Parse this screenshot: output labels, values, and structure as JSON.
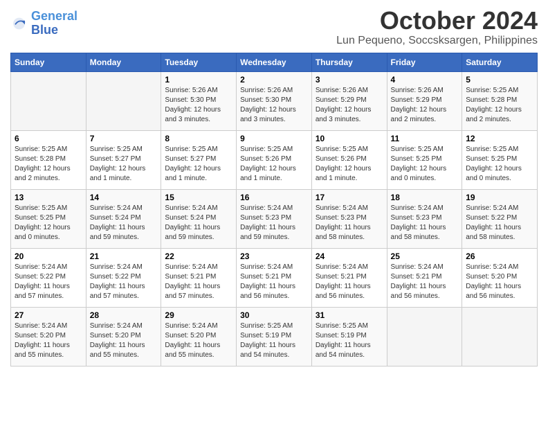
{
  "logo": {
    "text1": "General",
    "text2": "Blue"
  },
  "title": "October 2024",
  "subtitle": "Lun Pequeno, Soccsksargen, Philippines",
  "header_days": [
    "Sunday",
    "Monday",
    "Tuesday",
    "Wednesday",
    "Thursday",
    "Friday",
    "Saturday"
  ],
  "weeks": [
    [
      {
        "day": "",
        "sunrise": "",
        "sunset": "",
        "daylight": ""
      },
      {
        "day": "",
        "sunrise": "",
        "sunset": "",
        "daylight": ""
      },
      {
        "day": "1",
        "sunrise": "Sunrise: 5:26 AM",
        "sunset": "Sunset: 5:30 PM",
        "daylight": "Daylight: 12 hours and 3 minutes."
      },
      {
        "day": "2",
        "sunrise": "Sunrise: 5:26 AM",
        "sunset": "Sunset: 5:30 PM",
        "daylight": "Daylight: 12 hours and 3 minutes."
      },
      {
        "day": "3",
        "sunrise": "Sunrise: 5:26 AM",
        "sunset": "Sunset: 5:29 PM",
        "daylight": "Daylight: 12 hours and 3 minutes."
      },
      {
        "day": "4",
        "sunrise": "Sunrise: 5:26 AM",
        "sunset": "Sunset: 5:29 PM",
        "daylight": "Daylight: 12 hours and 2 minutes."
      },
      {
        "day": "5",
        "sunrise": "Sunrise: 5:25 AM",
        "sunset": "Sunset: 5:28 PM",
        "daylight": "Daylight: 12 hours and 2 minutes."
      }
    ],
    [
      {
        "day": "6",
        "sunrise": "Sunrise: 5:25 AM",
        "sunset": "Sunset: 5:28 PM",
        "daylight": "Daylight: 12 hours and 2 minutes."
      },
      {
        "day": "7",
        "sunrise": "Sunrise: 5:25 AM",
        "sunset": "Sunset: 5:27 PM",
        "daylight": "Daylight: 12 hours and 1 minute."
      },
      {
        "day": "8",
        "sunrise": "Sunrise: 5:25 AM",
        "sunset": "Sunset: 5:27 PM",
        "daylight": "Daylight: 12 hours and 1 minute."
      },
      {
        "day": "9",
        "sunrise": "Sunrise: 5:25 AM",
        "sunset": "Sunset: 5:26 PM",
        "daylight": "Daylight: 12 hours and 1 minute."
      },
      {
        "day": "10",
        "sunrise": "Sunrise: 5:25 AM",
        "sunset": "Sunset: 5:26 PM",
        "daylight": "Daylight: 12 hours and 1 minute."
      },
      {
        "day": "11",
        "sunrise": "Sunrise: 5:25 AM",
        "sunset": "Sunset: 5:25 PM",
        "daylight": "Daylight: 12 hours and 0 minutes."
      },
      {
        "day": "12",
        "sunrise": "Sunrise: 5:25 AM",
        "sunset": "Sunset: 5:25 PM",
        "daylight": "Daylight: 12 hours and 0 minutes."
      }
    ],
    [
      {
        "day": "13",
        "sunrise": "Sunrise: 5:25 AM",
        "sunset": "Sunset: 5:25 PM",
        "daylight": "Daylight: 12 hours and 0 minutes."
      },
      {
        "day": "14",
        "sunrise": "Sunrise: 5:24 AM",
        "sunset": "Sunset: 5:24 PM",
        "daylight": "Daylight: 11 hours and 59 minutes."
      },
      {
        "day": "15",
        "sunrise": "Sunrise: 5:24 AM",
        "sunset": "Sunset: 5:24 PM",
        "daylight": "Daylight: 11 hours and 59 minutes."
      },
      {
        "day": "16",
        "sunrise": "Sunrise: 5:24 AM",
        "sunset": "Sunset: 5:23 PM",
        "daylight": "Daylight: 11 hours and 59 minutes."
      },
      {
        "day": "17",
        "sunrise": "Sunrise: 5:24 AM",
        "sunset": "Sunset: 5:23 PM",
        "daylight": "Daylight: 11 hours and 58 minutes."
      },
      {
        "day": "18",
        "sunrise": "Sunrise: 5:24 AM",
        "sunset": "Sunset: 5:23 PM",
        "daylight": "Daylight: 11 hours and 58 minutes."
      },
      {
        "day": "19",
        "sunrise": "Sunrise: 5:24 AM",
        "sunset": "Sunset: 5:22 PM",
        "daylight": "Daylight: 11 hours and 58 minutes."
      }
    ],
    [
      {
        "day": "20",
        "sunrise": "Sunrise: 5:24 AM",
        "sunset": "Sunset: 5:22 PM",
        "daylight": "Daylight: 11 hours and 57 minutes."
      },
      {
        "day": "21",
        "sunrise": "Sunrise: 5:24 AM",
        "sunset": "Sunset: 5:22 PM",
        "daylight": "Daylight: 11 hours and 57 minutes."
      },
      {
        "day": "22",
        "sunrise": "Sunrise: 5:24 AM",
        "sunset": "Sunset: 5:21 PM",
        "daylight": "Daylight: 11 hours and 57 minutes."
      },
      {
        "day": "23",
        "sunrise": "Sunrise: 5:24 AM",
        "sunset": "Sunset: 5:21 PM",
        "daylight": "Daylight: 11 hours and 56 minutes."
      },
      {
        "day": "24",
        "sunrise": "Sunrise: 5:24 AM",
        "sunset": "Sunset: 5:21 PM",
        "daylight": "Daylight: 11 hours and 56 minutes."
      },
      {
        "day": "25",
        "sunrise": "Sunrise: 5:24 AM",
        "sunset": "Sunset: 5:21 PM",
        "daylight": "Daylight: 11 hours and 56 minutes."
      },
      {
        "day": "26",
        "sunrise": "Sunrise: 5:24 AM",
        "sunset": "Sunset: 5:20 PM",
        "daylight": "Daylight: 11 hours and 56 minutes."
      }
    ],
    [
      {
        "day": "27",
        "sunrise": "Sunrise: 5:24 AM",
        "sunset": "Sunset: 5:20 PM",
        "daylight": "Daylight: 11 hours and 55 minutes."
      },
      {
        "day": "28",
        "sunrise": "Sunrise: 5:24 AM",
        "sunset": "Sunset: 5:20 PM",
        "daylight": "Daylight: 11 hours and 55 minutes."
      },
      {
        "day": "29",
        "sunrise": "Sunrise: 5:24 AM",
        "sunset": "Sunset: 5:20 PM",
        "daylight": "Daylight: 11 hours and 55 minutes."
      },
      {
        "day": "30",
        "sunrise": "Sunrise: 5:25 AM",
        "sunset": "Sunset: 5:19 PM",
        "daylight": "Daylight: 11 hours and 54 minutes."
      },
      {
        "day": "31",
        "sunrise": "Sunrise: 5:25 AM",
        "sunset": "Sunset: 5:19 PM",
        "daylight": "Daylight: 11 hours and 54 minutes."
      },
      {
        "day": "",
        "sunrise": "",
        "sunset": "",
        "daylight": ""
      },
      {
        "day": "",
        "sunrise": "",
        "sunset": "",
        "daylight": ""
      }
    ]
  ]
}
